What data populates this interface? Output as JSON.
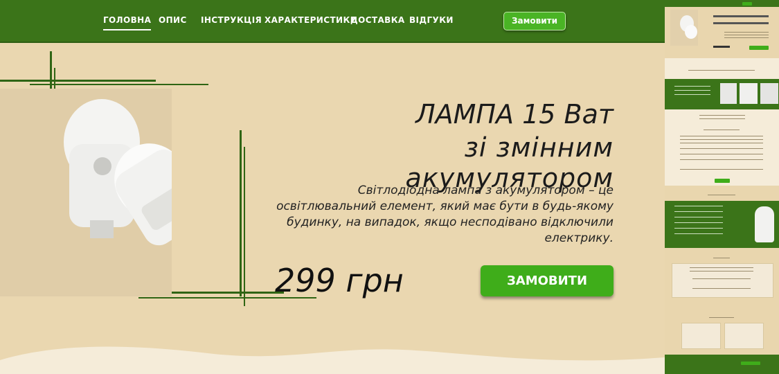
{
  "nav": {
    "items": [
      {
        "label": "ГОЛОВНА",
        "active": true
      },
      {
        "label": "ОПИС",
        "active": false
      },
      {
        "label": "ІНСТРУКЦІЯ",
        "active": false
      },
      {
        "label": "ХАРАКТЕРИСТИКИ",
        "active": false
      },
      {
        "label": "ДОСТАВКА",
        "active": false
      },
      {
        "label": "ВІДГУКИ",
        "active": false
      }
    ],
    "order_label": "Замовити"
  },
  "hero": {
    "title_line1": "ЛАМПА 15 Ват",
    "title_line2": "зі змінним акумулятором",
    "description": "Світлодіодна лампа з акумулятором – це освітлювальний елемент, який має бути в будь-якому будинку, на випадок, якщо несподівано відключили електрику.",
    "price": "299 грн",
    "order_label": "ЗАМОВИТИ",
    "product_image": "led-bulb-photo"
  },
  "colors": {
    "nav_bg": "#3b7419",
    "page_bg": "#ead7b0",
    "button": "#3fad1a",
    "accent_lines": "#2f6514"
  }
}
